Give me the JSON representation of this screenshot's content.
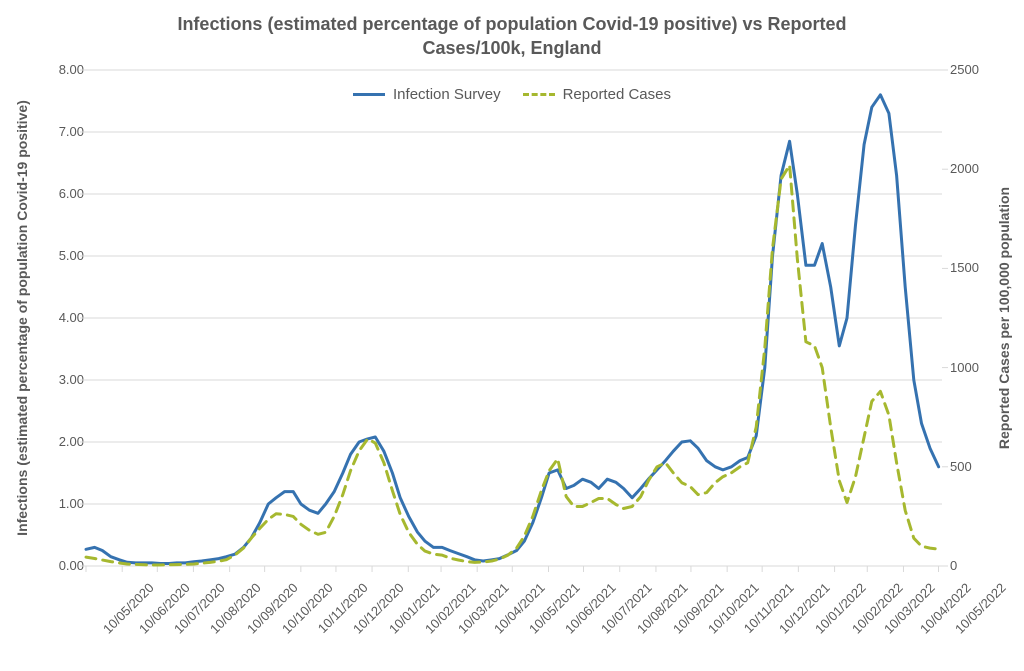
{
  "chart_data": {
    "type": "line",
    "title": "Infections (estimated percentage of population Covid-19 positive) vs Reported\nCases/100k, England",
    "xlabel": "",
    "ylabel_left": "Infections (estimated percentage of population Covid-19 positive)",
    "ylabel_right": "Reported Cases per 100,000 population",
    "ylim_left": [
      0,
      8
    ],
    "ylim_right": [
      0,
      2500
    ],
    "y_ticks_left": [
      "0.00",
      "1.00",
      "2.00",
      "3.00",
      "4.00",
      "5.00",
      "6.00",
      "7.00",
      "8.00"
    ],
    "y_ticks_right": [
      "0",
      "500",
      "1000",
      "1500",
      "2000",
      "2500"
    ],
    "x_tick_labels": [
      "10/05/2020",
      "10/06/2020",
      "10/07/2020",
      "10/08/2020",
      "10/09/2020",
      "10/10/2020",
      "10/11/2020",
      "10/12/2020",
      "10/01/2021",
      "10/02/2021",
      "10/03/2021",
      "10/04/2021",
      "10/05/2021",
      "10/06/2021",
      "10/07/2021",
      "10/08/2021",
      "10/09/2021",
      "10/10/2021",
      "10/11/2021",
      "10/12/2021",
      "10/01/2022",
      "10/02/2022",
      "10/03/2022",
      "10/04/2022",
      "10/05/2022"
    ],
    "x_tick_positions": [
      0.0,
      0.0423,
      0.0833,
      0.1255,
      0.1678,
      0.2087,
      0.251,
      0.292,
      0.3342,
      0.3765,
      0.4148,
      0.457,
      0.498,
      0.5403,
      0.5812,
      0.6235,
      0.6658,
      0.7067,
      0.749,
      0.7899,
      0.8322,
      0.8745,
      0.9127,
      0.955,
      0.9959
    ],
    "legend": {
      "infection": "Infection Survey",
      "reported": "Reported Cases"
    },
    "series": [
      {
        "name": "Infection Survey",
        "axis": "left",
        "color": "#3572b0",
        "style": "solid",
        "points": [
          [
            0.0,
            0.27
          ],
          [
            0.01,
            0.3
          ],
          [
            0.019,
            0.25
          ],
          [
            0.029,
            0.15
          ],
          [
            0.039,
            0.1
          ],
          [
            0.048,
            0.06
          ],
          [
            0.058,
            0.05
          ],
          [
            0.068,
            0.05
          ],
          [
            0.077,
            0.05
          ],
          [
            0.087,
            0.04
          ],
          [
            0.097,
            0.04
          ],
          [
            0.106,
            0.05
          ],
          [
            0.116,
            0.05
          ],
          [
            0.126,
            0.07
          ],
          [
            0.135,
            0.08
          ],
          [
            0.145,
            0.1
          ],
          [
            0.155,
            0.12
          ],
          [
            0.164,
            0.15
          ],
          [
            0.174,
            0.19
          ],
          [
            0.184,
            0.3
          ],
          [
            0.193,
            0.45
          ],
          [
            0.203,
            0.7
          ],
          [
            0.213,
            1.0
          ],
          [
            0.222,
            1.1
          ],
          [
            0.232,
            1.2
          ],
          [
            0.242,
            1.2
          ],
          [
            0.251,
            1.0
          ],
          [
            0.261,
            0.9
          ],
          [
            0.271,
            0.85
          ],
          [
            0.28,
            1.0
          ],
          [
            0.29,
            1.2
          ],
          [
            0.3,
            1.5
          ],
          [
            0.309,
            1.8
          ],
          [
            0.319,
            2.0
          ],
          [
            0.329,
            2.05
          ],
          [
            0.338,
            2.08
          ],
          [
            0.348,
            1.85
          ],
          [
            0.358,
            1.5
          ],
          [
            0.367,
            1.1
          ],
          [
            0.377,
            0.8
          ],
          [
            0.387,
            0.55
          ],
          [
            0.396,
            0.4
          ],
          [
            0.406,
            0.3
          ],
          [
            0.416,
            0.3
          ],
          [
            0.425,
            0.25
          ],
          [
            0.435,
            0.2
          ],
          [
            0.445,
            0.15
          ],
          [
            0.454,
            0.1
          ],
          [
            0.464,
            0.08
          ],
          [
            0.474,
            0.1
          ],
          [
            0.483,
            0.12
          ],
          [
            0.493,
            0.18
          ],
          [
            0.503,
            0.25
          ],
          [
            0.512,
            0.4
          ],
          [
            0.522,
            0.7
          ],
          [
            0.532,
            1.1
          ],
          [
            0.541,
            1.5
          ],
          [
            0.551,
            1.55
          ],
          [
            0.561,
            1.25
          ],
          [
            0.57,
            1.3
          ],
          [
            0.58,
            1.4
          ],
          [
            0.59,
            1.35
          ],
          [
            0.599,
            1.25
          ],
          [
            0.609,
            1.4
          ],
          [
            0.619,
            1.35
          ],
          [
            0.628,
            1.25
          ],
          [
            0.638,
            1.1
          ],
          [
            0.648,
            1.25
          ],
          [
            0.657,
            1.4
          ],
          [
            0.667,
            1.55
          ],
          [
            0.677,
            1.7
          ],
          [
            0.686,
            1.85
          ],
          [
            0.696,
            2.0
          ],
          [
            0.706,
            2.02
          ],
          [
            0.715,
            1.9
          ],
          [
            0.725,
            1.7
          ],
          [
            0.735,
            1.6
          ],
          [
            0.744,
            1.55
          ],
          [
            0.754,
            1.6
          ],
          [
            0.764,
            1.7
          ],
          [
            0.773,
            1.75
          ],
          [
            0.783,
            2.1
          ],
          [
            0.793,
            3.2
          ],
          [
            0.802,
            5.0
          ],
          [
            0.812,
            6.3
          ],
          [
            0.822,
            6.85
          ],
          [
            0.831,
            6.0
          ],
          [
            0.841,
            4.85
          ],
          [
            0.851,
            4.85
          ],
          [
            0.86,
            5.2
          ],
          [
            0.87,
            4.5
          ],
          [
            0.88,
            3.55
          ],
          [
            0.889,
            4.0
          ],
          [
            0.899,
            5.5
          ],
          [
            0.909,
            6.8
          ],
          [
            0.918,
            7.4
          ],
          [
            0.928,
            7.6
          ],
          [
            0.938,
            7.3
          ],
          [
            0.947,
            6.3
          ],
          [
            0.957,
            4.5
          ],
          [
            0.967,
            3.0
          ],
          [
            0.976,
            2.3
          ],
          [
            0.986,
            1.9
          ],
          [
            0.996,
            1.6
          ]
        ]
      },
      {
        "name": "Reported Cases",
        "axis": "right",
        "color": "#a6b82f",
        "style": "dashed",
        "points": [
          [
            0.0,
            45
          ],
          [
            0.01,
            38
          ],
          [
            0.019,
            30
          ],
          [
            0.029,
            22
          ],
          [
            0.039,
            15
          ],
          [
            0.048,
            10
          ],
          [
            0.058,
            8
          ],
          [
            0.068,
            6
          ],
          [
            0.077,
            5
          ],
          [
            0.087,
            5
          ],
          [
            0.097,
            6
          ],
          [
            0.106,
            7
          ],
          [
            0.116,
            8
          ],
          [
            0.126,
            10
          ],
          [
            0.135,
            14
          ],
          [
            0.145,
            18
          ],
          [
            0.155,
            24
          ],
          [
            0.164,
            32
          ],
          [
            0.174,
            55
          ],
          [
            0.184,
            90
          ],
          [
            0.193,
            140
          ],
          [
            0.203,
            190
          ],
          [
            0.213,
            235
          ],
          [
            0.222,
            263
          ],
          [
            0.232,
            260
          ],
          [
            0.242,
            250
          ],
          [
            0.251,
            210
          ],
          [
            0.261,
            180
          ],
          [
            0.271,
            160
          ],
          [
            0.28,
            170
          ],
          [
            0.29,
            250
          ],
          [
            0.3,
            360
          ],
          [
            0.309,
            480
          ],
          [
            0.319,
            580
          ],
          [
            0.329,
            640
          ],
          [
            0.338,
            620
          ],
          [
            0.348,
            520
          ],
          [
            0.358,
            380
          ],
          [
            0.367,
            260
          ],
          [
            0.377,
            170
          ],
          [
            0.387,
            110
          ],
          [
            0.396,
            75
          ],
          [
            0.406,
            60
          ],
          [
            0.416,
            55
          ],
          [
            0.425,
            40
          ],
          [
            0.435,
            30
          ],
          [
            0.445,
            22
          ],
          [
            0.454,
            18
          ],
          [
            0.464,
            20
          ],
          [
            0.474,
            25
          ],
          [
            0.483,
            35
          ],
          [
            0.493,
            55
          ],
          [
            0.503,
            90
          ],
          [
            0.512,
            150
          ],
          [
            0.522,
            250
          ],
          [
            0.532,
            380
          ],
          [
            0.541,
            480
          ],
          [
            0.551,
            540
          ],
          [
            0.561,
            350
          ],
          [
            0.57,
            300
          ],
          [
            0.58,
            300
          ],
          [
            0.59,
            320
          ],
          [
            0.599,
            340
          ],
          [
            0.609,
            340
          ],
          [
            0.619,
            310
          ],
          [
            0.628,
            290
          ],
          [
            0.638,
            300
          ],
          [
            0.648,
            350
          ],
          [
            0.657,
            430
          ],
          [
            0.667,
            500
          ],
          [
            0.677,
            520
          ],
          [
            0.686,
            470
          ],
          [
            0.696,
            420
          ],
          [
            0.706,
            400
          ],
          [
            0.715,
            360
          ],
          [
            0.725,
            370
          ],
          [
            0.735,
            420
          ],
          [
            0.744,
            450
          ],
          [
            0.754,
            470
          ],
          [
            0.764,
            500
          ],
          [
            0.773,
            520
          ],
          [
            0.783,
            700
          ],
          [
            0.793,
            1100
          ],
          [
            0.802,
            1600
          ],
          [
            0.812,
            1950
          ],
          [
            0.822,
            2020
          ],
          [
            0.831,
            1550
          ],
          [
            0.841,
            1130
          ],
          [
            0.851,
            1110
          ],
          [
            0.86,
            1000
          ],
          [
            0.87,
            700
          ],
          [
            0.88,
            430
          ],
          [
            0.889,
            320
          ],
          [
            0.899,
            450
          ],
          [
            0.909,
            650
          ],
          [
            0.918,
            830
          ],
          [
            0.928,
            880
          ],
          [
            0.938,
            760
          ],
          [
            0.947,
            520
          ],
          [
            0.957,
            280
          ],
          [
            0.967,
            140
          ],
          [
            0.976,
            100
          ],
          [
            0.986,
            90
          ],
          [
            0.996,
            85
          ]
        ]
      }
    ]
  }
}
